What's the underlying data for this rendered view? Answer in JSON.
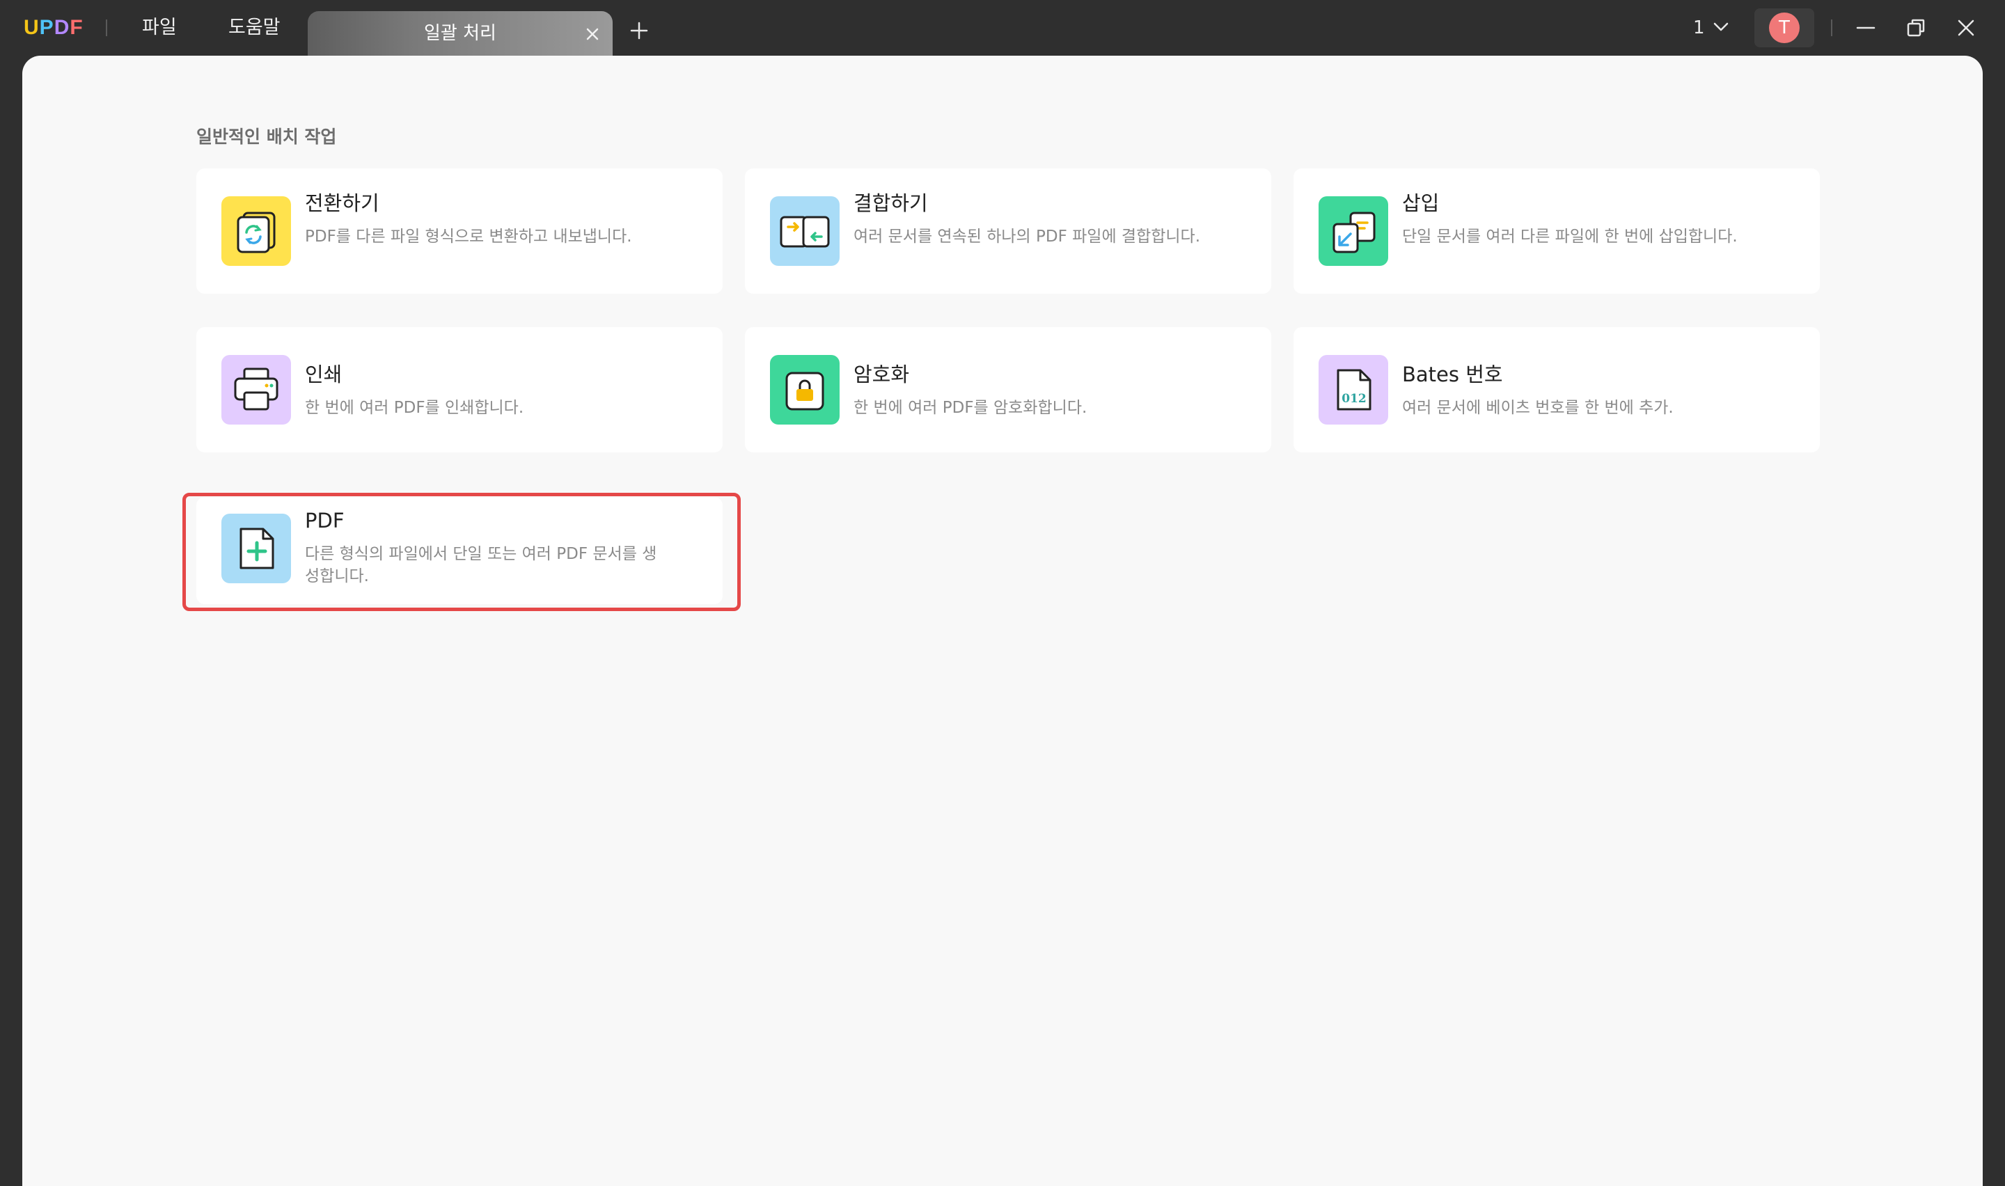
{
  "app": {
    "logo_letters": [
      "U",
      "P",
      "D",
      "F"
    ],
    "menu": {
      "file": "파일",
      "help": "도움말"
    }
  },
  "tabs": [
    {
      "label": "일괄 처리",
      "active": true
    }
  ],
  "toolbar": {
    "page_count": "1",
    "avatar_initial": "T"
  },
  "colors": {
    "highlight": "#e54848",
    "convert_icon_bg": "#ffe24d",
    "combine_icon_bg": "#a9dcf7",
    "insert_icon_bg": "#3ed79a",
    "print_icon_bg": "#e3ccff",
    "encrypt_icon_bg": "#3ed79a",
    "bates_icon_bg": "#e3ccff",
    "create_icon_bg": "#a9dcf7"
  },
  "main": {
    "section_title": "일반적인 배치 작업",
    "cards": [
      {
        "id": "convert",
        "icon": "convert-icon",
        "title": "전환하기",
        "desc": "PDF를 다른 파일 형식으로 변환하고 내보냅니다."
      },
      {
        "id": "combine",
        "icon": "combine-icon",
        "title": "결합하기",
        "desc": "여러 문서를 연속된 하나의 PDF 파일에 결합합니다."
      },
      {
        "id": "insert",
        "icon": "insert-icon",
        "title": "삽입",
        "desc": "단일 문서를 여러 다른 파일에 한 번에 삽입합니다."
      },
      {
        "id": "print",
        "icon": "printer-icon",
        "title": "인쇄",
        "desc": "한 번에 여러 PDF를 인쇄합니다."
      },
      {
        "id": "encrypt",
        "icon": "lock-icon",
        "title": "암호화",
        "desc": "한 번에 여러 PDF를 암호화합니다."
      },
      {
        "id": "bates",
        "icon": "bates-number-icon",
        "title": "Bates 번호",
        "desc": "여러 문서에 베이츠 번호를 한 번에 추가.",
        "icon_text": "012"
      },
      {
        "id": "create",
        "icon": "create-pdf-icon",
        "title": "PDF",
        "desc": "다른 형식의 파일에서 단일 또는 여러 PDF 문서를 생성합니다.",
        "highlighted": true
      }
    ]
  }
}
